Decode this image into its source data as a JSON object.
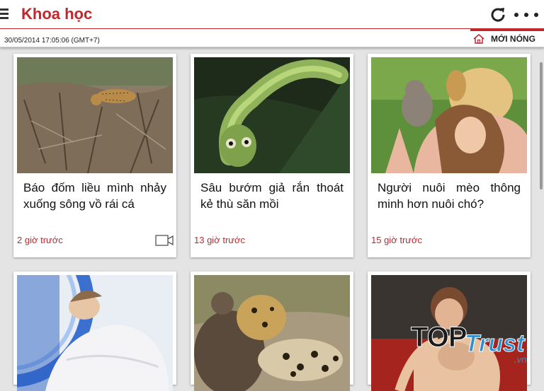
{
  "header": {
    "title": "Khoa học",
    "menu_icon": "hamburger-icon",
    "refresh_icon": "refresh-icon",
    "more_icon": "more-dots-icon",
    "accent_color": "#c1272d"
  },
  "subbar": {
    "datetime": "30/05/2014 17:05:06 (GMT+7)",
    "hot_label": "MỚI NÓNG",
    "home_icon": "home-icon"
  },
  "articles": [
    {
      "title": "Báo đốm liều mình nhảy xuống sông vồ rái cá",
      "time": "2 giờ trước",
      "has_video": true,
      "image": "jaguar-on-riverbank"
    },
    {
      "title": "Sâu bướm giả rắn thoát kẻ thù săn mồi",
      "time": "13 giờ trước",
      "has_video": false,
      "image": "snake-mimic-caterpillar"
    },
    {
      "title": "Người nuôi mèo thông minh hơn nuôi chó?",
      "time": "15 giờ trước",
      "has_video": false,
      "image": "woman-with-kitten-and-dog"
    },
    {
      "title": "",
      "time": "",
      "has_video": false,
      "image": "woman-in-mri-scanner"
    },
    {
      "title": "",
      "time": "",
      "has_video": false,
      "image": "leopard-and-animals"
    },
    {
      "title": "",
      "time": "",
      "has_video": false,
      "image": "mother-and-baby"
    }
  ],
  "watermark": {
    "top": "TOP",
    "trust": "Trust",
    "domain": ".vn"
  }
}
